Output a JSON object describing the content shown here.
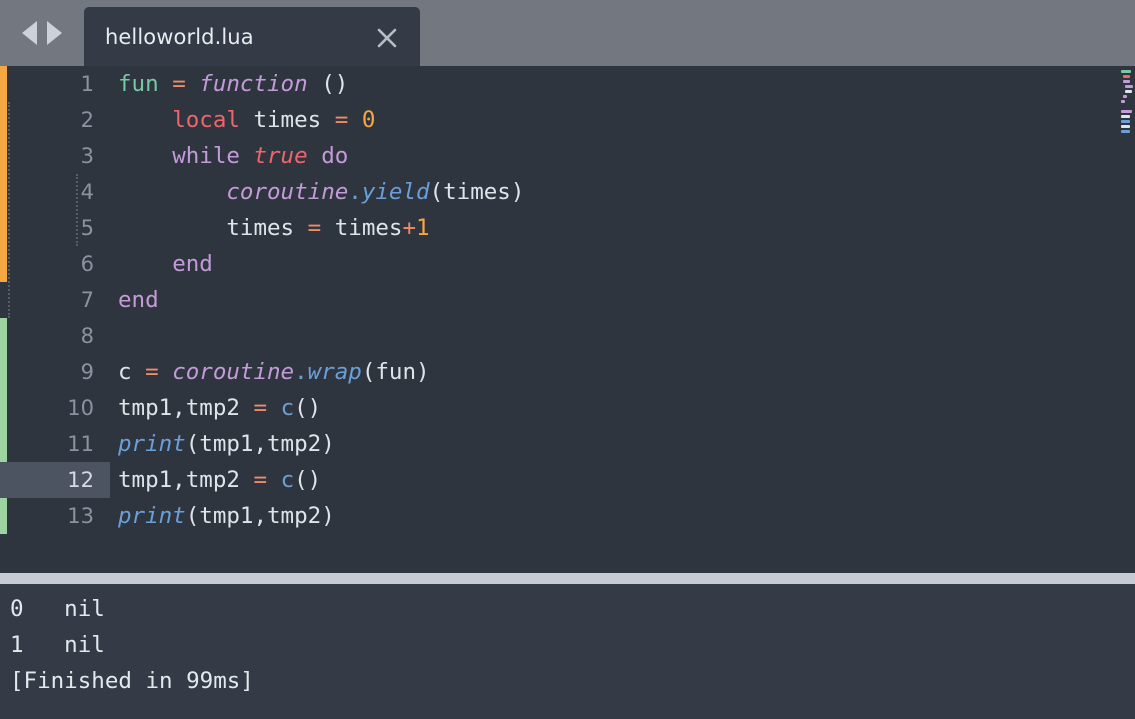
{
  "window": {
    "title": "helloworld.lua"
  },
  "tabbar": {
    "prev_arrow": "nav-prev-arrow",
    "next_arrow": "nav-next-arrow",
    "tabs": [
      {
        "label": "helloworld.lua",
        "close_label": "×",
        "active": true
      }
    ]
  },
  "editor": {
    "language": "lua",
    "active_line": 12,
    "line_numbers": [
      "1",
      "2",
      "3",
      "4",
      "5",
      "6",
      "7",
      "8",
      "9",
      "10",
      "11",
      "12",
      "13"
    ],
    "lines": [
      {
        "n": 1,
        "text": "fun = function ()"
      },
      {
        "n": 2,
        "text": "    local times = 0"
      },
      {
        "n": 3,
        "text": "    while true do"
      },
      {
        "n": 4,
        "text": "        coroutine.yield(times)"
      },
      {
        "n": 5,
        "text": "        times = times+1"
      },
      {
        "n": 6,
        "text": "    end"
      },
      {
        "n": 7,
        "text": "end"
      },
      {
        "n": 8,
        "text": ""
      },
      {
        "n": 9,
        "text": "c = coroutine.wrap(fun)"
      },
      {
        "n": 10,
        "text": "tmp1,tmp2 = c()"
      },
      {
        "n": 11,
        "text": "print(tmp1,tmp2)"
      },
      {
        "n": 12,
        "text": "tmp1,tmp2 = c()"
      },
      {
        "n": 13,
        "text": "print(tmp1,tmp2)"
      }
    ],
    "change_markers": [
      {
        "kind": "modified",
        "color": "#f5a742",
        "from_line": 1,
        "to_line": 6
      },
      {
        "kind": "added",
        "color": "#9cd3a0",
        "from_line": 9,
        "to_line": 13
      }
    ]
  },
  "console": {
    "lines": [
      "0   nil",
      "1   nil",
      "[Finished in 99ms]"
    ]
  },
  "colors": {
    "tabbar_bg": "#73777f",
    "tab_active_bg": "#343b46",
    "editor_bg": "#2f353f",
    "console_bg": "#343b46",
    "divider": "#c5cad3",
    "gutter_text": "#8a939f",
    "active_line_gutter": "#4b5460",
    "text": "#dfe4ea",
    "variable": "#77c9a6",
    "operator": "#f08a68",
    "keyword": "#c39bd8",
    "constant": "#f0656a",
    "number": "#f5a742",
    "function": "#6a9fd8",
    "marker_modified": "#f5a742",
    "marker_added": "#9cd3a0"
  }
}
